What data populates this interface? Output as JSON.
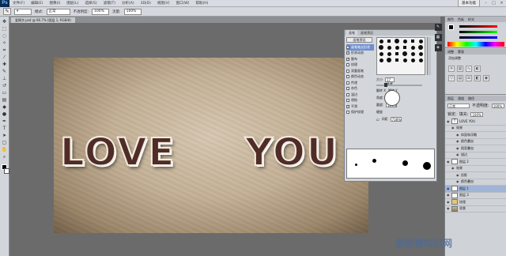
{
  "app": {
    "logo": "Ps"
  },
  "menu": {
    "items": [
      "文件(F)",
      "编辑(E)",
      "图像(I)",
      "图层(L)",
      "选择(S)",
      "滤镜(T)",
      "分析(A)",
      "3D(D)",
      "视图(V)",
      "窗口(W)",
      "帮助(H)"
    ],
    "workspace": "基本功能"
  },
  "options": {
    "mode_label": "模式:",
    "mode_value": "正常",
    "opacity_label": "不透明度:",
    "opacity_value": "100%",
    "flow_label": "流量:",
    "flow_value": "100%"
  },
  "document": {
    "tab": "爱情字.psd @ 66.7% (图层 1, RGB/8)"
  },
  "canvas": {
    "text_left": "LOVE",
    "text_right": "YOU"
  },
  "brush_panel": {
    "tabs": [
      "画笔",
      "画笔预设"
    ],
    "preset_button": "画笔预设",
    "options": [
      {
        "label": "画笔笔尖形状",
        "checked": false,
        "selected": true
      },
      {
        "label": "形状动态",
        "checked": true
      },
      {
        "label": "散布",
        "checked": true
      },
      {
        "label": "纹理",
        "checked": false
      },
      {
        "label": "双重画笔",
        "checked": false
      },
      {
        "label": "颜色动态",
        "checked": false
      },
      {
        "label": "传递",
        "checked": false
      },
      {
        "label": "杂色",
        "checked": false
      },
      {
        "label": "湿边",
        "checked": false
      },
      {
        "label": "喷枪",
        "checked": false
      },
      {
        "label": "平滑",
        "checked": true
      },
      {
        "label": "保护纹理",
        "checked": false
      }
    ],
    "size_label": "大小",
    "size_value": "17 像素",
    "flip_x": "翻转 X",
    "flip_y": "翻转 Y",
    "angle_label": "角度:",
    "angle_value": "0°",
    "roundness_label": "圆度:",
    "roundness_value": "100%",
    "hardness_label": "硬度",
    "spacing_label": "间距",
    "spacing_value": "738%"
  },
  "color_panel": {
    "tabs": [
      "颜色",
      "色板",
      "样式"
    ]
  },
  "adjust_panel": {
    "tabs": [
      "调整",
      "蒙版"
    ],
    "title": "添加调整"
  },
  "layers_panel": {
    "tabs": [
      "图层",
      "通道",
      "路径"
    ],
    "blend": "正常",
    "opacity_label": "不透明度:",
    "opacity_value": "100%",
    "lock_label": "锁定:",
    "fill_label": "填充:",
    "fill_value": "100%",
    "layers": [
      {
        "name": "LOVE YOU",
        "type": "t",
        "indent": 0,
        "selected": false
      },
      {
        "name": "效果",
        "type": "fx",
        "indent": 1,
        "selected": false
      },
      {
        "name": "斜面和浮雕",
        "type": "fx",
        "indent": 2,
        "selected": false
      },
      {
        "name": "颜色叠加",
        "type": "fx",
        "indent": 2,
        "selected": false
      },
      {
        "name": "图案叠加",
        "type": "fx",
        "indent": 2,
        "selected": false
      },
      {
        "name": "描边",
        "type": "fx",
        "indent": 2,
        "selected": false
      },
      {
        "name": "图层 2",
        "type": "layer",
        "indent": 0,
        "selected": false
      },
      {
        "name": "效果",
        "type": "fx",
        "indent": 1,
        "selected": false
      },
      {
        "name": "投影",
        "type": "fx",
        "indent": 2,
        "selected": false
      },
      {
        "name": "颜色叠加",
        "type": "fx",
        "indent": 2,
        "selected": false
      },
      {
        "name": "图层 1",
        "type": "layer",
        "indent": 0,
        "selected": true
      },
      {
        "name": "图层 3",
        "type": "layer",
        "indent": 0,
        "selected": false
      },
      {
        "name": "纹理",
        "type": "folder",
        "indent": 0,
        "selected": false
      },
      {
        "name": "背景",
        "type": "bg",
        "indent": 0,
        "selected": false
      }
    ]
  },
  "watermark": "爱创根知识网"
}
